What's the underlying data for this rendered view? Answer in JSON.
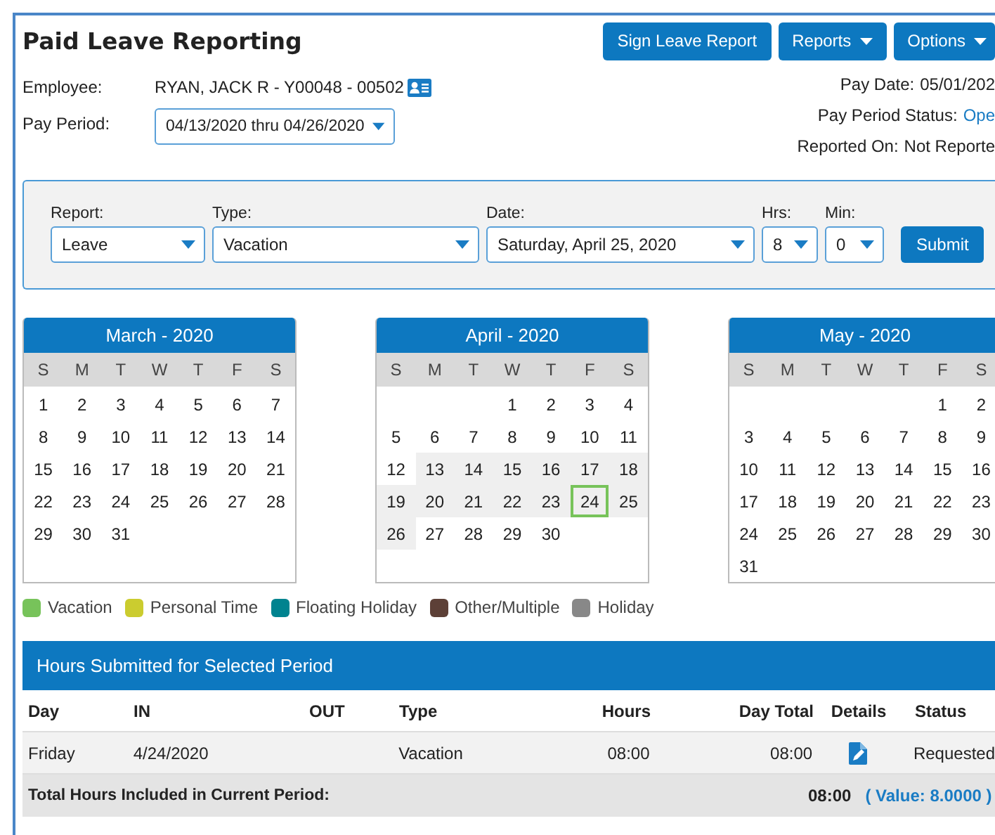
{
  "title": "Paid Leave Reporting",
  "header_buttons": [
    {
      "label": "Sign Leave Report",
      "dropdown": false
    },
    {
      "label": "Reports",
      "dropdown": true
    },
    {
      "label": "Options",
      "dropdown": true
    }
  ],
  "employee": {
    "label": "Employee:",
    "value": "RYAN, JACK R - Y00048 - 00502"
  },
  "pay_period": {
    "label": "Pay Period:",
    "value": "04/13/2020 thru 04/26/2020"
  },
  "pay_info": [
    {
      "label": "Pay Date:",
      "value": "05/01/202",
      "link": false
    },
    {
      "label": "Pay Period Status:",
      "value": "Ope",
      "link": true
    },
    {
      "label": "Reported On:",
      "value": "Not Reporte",
      "link": false
    }
  ],
  "form": {
    "fields": [
      {
        "label": "Report:",
        "value": "Leave"
      },
      {
        "label": "Type:",
        "value": "Vacation"
      },
      {
        "label": "Date:",
        "value": "Saturday, April 25, 2020"
      },
      {
        "label": "Hrs:",
        "value": "8"
      },
      {
        "label": "Min:",
        "value": "0"
      }
    ],
    "submit": "Submit"
  },
  "calendars": [
    {
      "title": "March - 2020",
      "weekdays": [
        "S",
        "M",
        "T",
        "W",
        "T",
        "F",
        "S"
      ],
      "weeks": [
        [
          {
            "day": "1",
            "in_period": false
          },
          {
            "day": "2",
            "in_period": false
          },
          {
            "day": "3",
            "in_period": false
          },
          {
            "day": "4",
            "in_period": false
          },
          {
            "day": "5",
            "in_period": false
          },
          {
            "day": "6",
            "in_period": false
          },
          {
            "day": "7",
            "in_period": false
          }
        ],
        [
          {
            "day": "8",
            "in_period": false
          },
          {
            "day": "9",
            "in_period": false
          },
          {
            "day": "10",
            "in_period": false
          },
          {
            "day": "11",
            "in_period": false
          },
          {
            "day": "12",
            "in_period": false
          },
          {
            "day": "13",
            "in_period": false
          },
          {
            "day": "14",
            "in_period": false
          }
        ],
        [
          {
            "day": "15",
            "in_period": false
          },
          {
            "day": "16",
            "in_period": false
          },
          {
            "day": "17",
            "in_period": false
          },
          {
            "day": "18",
            "in_period": false
          },
          {
            "day": "19",
            "in_period": false
          },
          {
            "day": "20",
            "in_period": false
          },
          {
            "day": "21",
            "in_period": false
          }
        ],
        [
          {
            "day": "22",
            "in_period": false
          },
          {
            "day": "23",
            "in_period": false
          },
          {
            "day": "24",
            "in_period": false
          },
          {
            "day": "25",
            "in_period": false
          },
          {
            "day": "26",
            "in_period": false
          },
          {
            "day": "27",
            "in_period": false
          },
          {
            "day": "28",
            "in_period": false
          }
        ],
        [
          {
            "day": "29",
            "in_period": false
          },
          {
            "day": "30",
            "in_period": false
          },
          {
            "day": "31",
            "in_period": false
          }
        ]
      ]
    },
    {
      "title": "April - 2020",
      "weekdays": [
        "S",
        "M",
        "T",
        "W",
        "T",
        "F",
        "S"
      ],
      "weeks": [
        [
          {
            "day": "1",
            "in_period": false
          },
          {
            "day": "2",
            "in_period": false
          },
          {
            "day": "3",
            "in_period": false
          },
          {
            "day": "4",
            "in_period": false
          }
        ],
        [
          {
            "day": "5",
            "in_period": false
          },
          {
            "day": "6",
            "in_period": false
          },
          {
            "day": "7",
            "in_period": false
          },
          {
            "day": "8",
            "in_period": false
          },
          {
            "day": "9",
            "in_period": false
          },
          {
            "day": "10",
            "in_period": false
          },
          {
            "day": "11",
            "in_period": false
          }
        ],
        [
          {
            "day": "12",
            "in_period": false
          },
          {
            "day": "13",
            "in_period": true
          },
          {
            "day": "14",
            "in_period": true
          },
          {
            "day": "15",
            "in_period": true
          },
          {
            "day": "16",
            "in_period": true
          },
          {
            "day": "17",
            "in_period": true
          },
          {
            "day": "18",
            "in_period": true
          }
        ],
        [
          {
            "day": "19",
            "in_period": true
          },
          {
            "day": "20",
            "in_period": true
          },
          {
            "day": "21",
            "in_period": true
          },
          {
            "day": "22",
            "in_period": true
          },
          {
            "day": "23",
            "in_period": true
          },
          {
            "day": "24",
            "in_period": true,
            "color": "#77c35a"
          },
          {
            "day": "25",
            "in_period": true
          }
        ],
        [
          {
            "day": "26",
            "in_period": true
          },
          {
            "day": "27",
            "in_period": false
          },
          {
            "day": "28",
            "in_period": false
          },
          {
            "day": "29",
            "in_period": false
          },
          {
            "day": "30",
            "in_period": false
          }
        ]
      ]
    },
    {
      "title": "May - 2020",
      "weekdays": [
        "S",
        "M",
        "T",
        "W",
        "T",
        "F",
        "S"
      ],
      "weeks": [
        [
          {
            "day": "1",
            "in_period": false
          },
          {
            "day": "2",
            "in_period": false
          }
        ],
        [
          {
            "day": "3",
            "in_period": false
          },
          {
            "day": "4",
            "in_period": false
          },
          {
            "day": "5",
            "in_period": false
          },
          {
            "day": "6",
            "in_period": false
          },
          {
            "day": "7",
            "in_period": false
          },
          {
            "day": "8",
            "in_period": false
          },
          {
            "day": "9",
            "in_period": false
          }
        ],
        [
          {
            "day": "10",
            "in_period": false
          },
          {
            "day": "11",
            "in_period": false
          },
          {
            "day": "12",
            "in_period": false
          },
          {
            "day": "13",
            "in_period": false
          },
          {
            "day": "14",
            "in_period": false
          },
          {
            "day": "15",
            "in_period": false
          },
          {
            "day": "16",
            "in_period": false
          }
        ],
        [
          {
            "day": "17",
            "in_period": false
          },
          {
            "day": "18",
            "in_period": false
          },
          {
            "day": "19",
            "in_period": false
          },
          {
            "day": "20",
            "in_period": false
          },
          {
            "day": "21",
            "in_period": false
          },
          {
            "day": "22",
            "in_period": false
          },
          {
            "day": "23",
            "in_period": false
          }
        ],
        [
          {
            "day": "24",
            "in_period": false
          },
          {
            "day": "25",
            "in_period": false
          },
          {
            "day": "26",
            "in_period": false
          },
          {
            "day": "27",
            "in_period": false
          },
          {
            "day": "28",
            "in_period": false
          },
          {
            "day": "29",
            "in_period": false
          },
          {
            "day": "30",
            "in_period": false
          }
        ],
        [
          {
            "day": "31",
            "in_period": false
          }
        ]
      ]
    }
  ],
  "legend": [
    {
      "label": "Vacation",
      "color": "#77c35a"
    },
    {
      "label": "Personal Time",
      "color": "#cbcc2f"
    },
    {
      "label": "Floating Holiday",
      "color": "#00838f"
    },
    {
      "label": "Other/Multiple",
      "color": "#5d4037"
    },
    {
      "label": "Holiday",
      "color": "#888888"
    }
  ],
  "hours": {
    "title": "Hours Submitted for Selected Period",
    "columns": [
      "Day",
      "IN",
      "OUT",
      "Type",
      "Hours",
      "Day Total",
      "Details",
      "Status"
    ],
    "rows": [
      {
        "day": "Friday",
        "in": "4/24/2020",
        "type": "Vacation",
        "hours": "08:00",
        "day_total": "08:00",
        "status": "Requested"
      }
    ],
    "total": {
      "label": "Total Hours Included in Current Period:",
      "hours": "08:00",
      "value": "( Value: 8.0000 )"
    }
  }
}
